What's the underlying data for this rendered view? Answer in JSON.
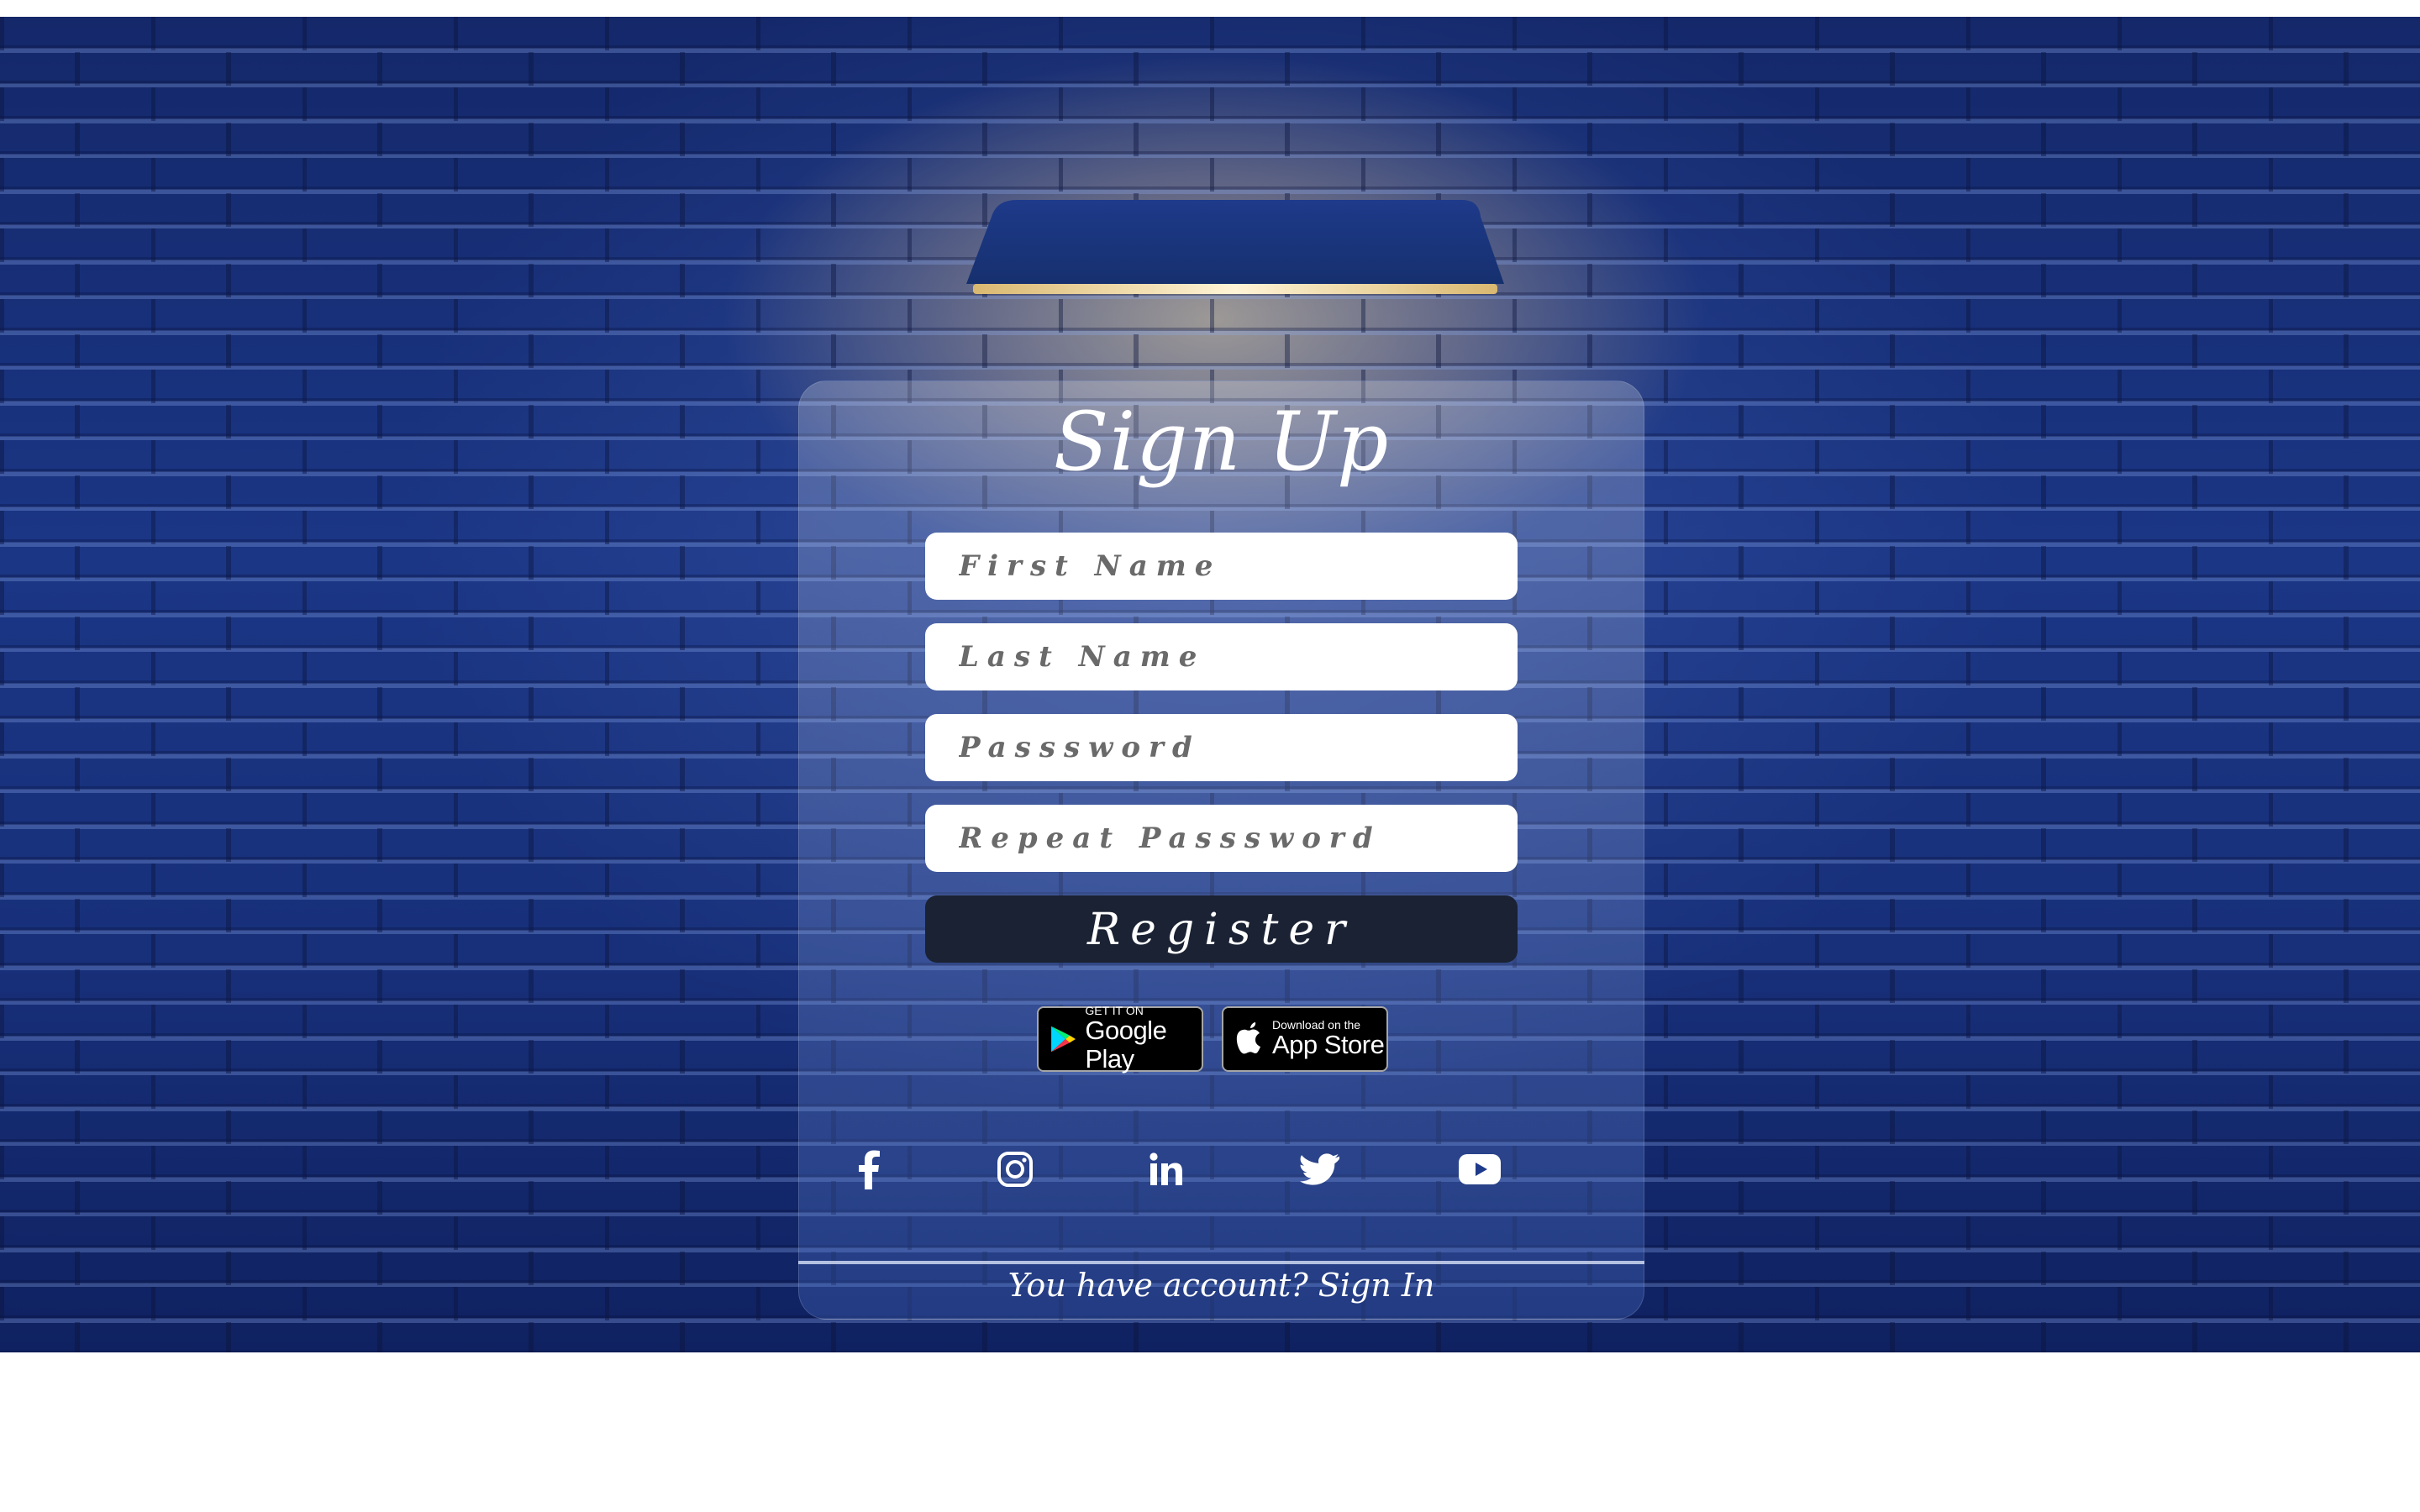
{
  "signup": {
    "title": "Sign Up",
    "fields": {
      "first_name": {
        "placeholder": "First Name",
        "value": ""
      },
      "last_name": {
        "placeholder": "Last Name",
        "value": ""
      },
      "password": {
        "placeholder": "Passsword",
        "value": ""
      },
      "repeat_password": {
        "placeholder": "Repeat Passsword",
        "value": ""
      }
    },
    "register_label": "Register"
  },
  "stores": {
    "google": {
      "small": "GET IT ON",
      "big": "Google Play"
    },
    "apple": {
      "small": "Download on the",
      "big": "App Store"
    }
  },
  "social": {
    "icons": [
      "facebook-icon",
      "instagram-icon",
      "linkedin-icon",
      "twitter-icon",
      "youtube-icon"
    ]
  },
  "footer": {
    "prompt": "You have account?",
    "link": "Sign In"
  },
  "colors": {
    "background": "#1b3685",
    "register_button": "#1a2233",
    "field_background": "#ffffff",
    "lamp_light": "#ffe2a0"
  }
}
